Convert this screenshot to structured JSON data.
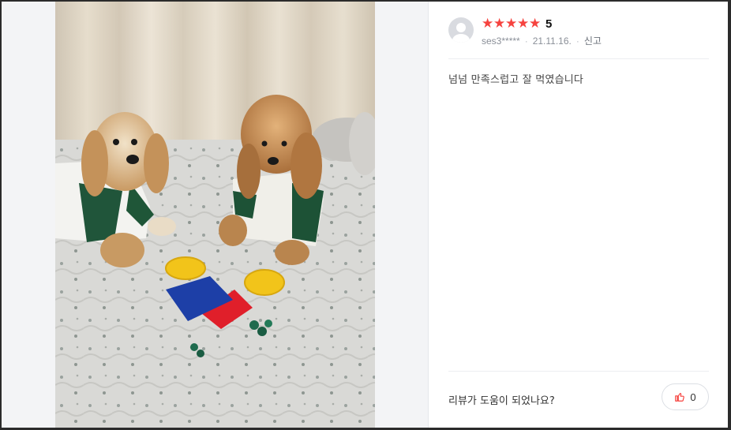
{
  "photo": {
    "alt": ""
  },
  "review": {
    "rating_stars": 5,
    "rating_value": "5",
    "username": "ses3*****",
    "date": "21.11.16.",
    "report_label": "신고",
    "text": "넘넘 만족스럽고 잘 먹였습니다"
  },
  "helpful": {
    "question": "리뷰가 도움이 되었나요?",
    "like_count": "0"
  },
  "colors": {
    "star": "#f6433f",
    "like_icon": "#f6433f"
  },
  "icons": {
    "avatar": "user-avatar-icon",
    "like": "thumbs-up-icon"
  }
}
